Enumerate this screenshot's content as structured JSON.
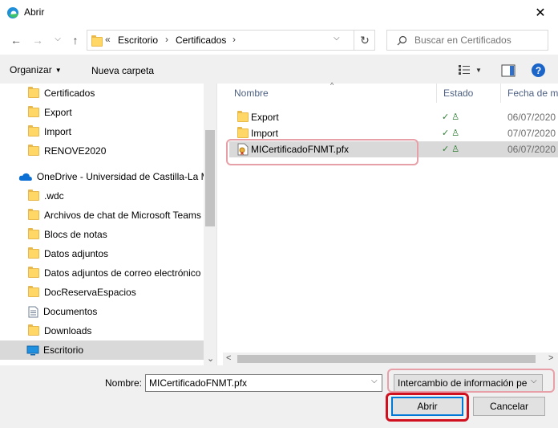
{
  "window": {
    "title": "Abrir",
    "close_glyph": "✕"
  },
  "nav": {
    "back_glyph": "←",
    "forward_glyph": "→",
    "dropdown_glyph": "⌵",
    "up_glyph": "↑",
    "address_prefix": "«",
    "path": [
      "Escritorio",
      "Certificados"
    ],
    "path_sep": "›",
    "address_dropdown_glyph": "⌵",
    "refresh_glyph": "↻",
    "search_placeholder": "Buscar en Certificados"
  },
  "toolbar": {
    "organize_label": "Organizar",
    "organize_arrow": "▼",
    "new_folder_label": "Nueva carpeta",
    "view_arrow": "▼",
    "help_glyph": "?"
  },
  "tree": [
    {
      "label": "Certificados",
      "icon": "folder-icon"
    },
    {
      "label": "Export",
      "icon": "folder-icon"
    },
    {
      "label": "Import",
      "icon": "folder-icon"
    },
    {
      "label": "RENOVE2020",
      "icon": "folder-icon"
    },
    {
      "label": "OneDrive - Universidad de Castilla-La Mancha",
      "icon": "onedrive-icon"
    },
    {
      "label": ".wdc",
      "icon": "folder-icon"
    },
    {
      "label": "Archivos de chat de Microsoft Teams",
      "icon": "folder-icon"
    },
    {
      "label": "Blocs de notas",
      "icon": "folder-icon"
    },
    {
      "label": "Datos adjuntos",
      "icon": "folder-icon"
    },
    {
      "label": "Datos adjuntos de correo electrónico",
      "icon": "folder-icon"
    },
    {
      "label": "DocReservaEspacios",
      "icon": "folder-icon"
    },
    {
      "label": "Documentos",
      "icon": "document-icon"
    },
    {
      "label": "Downloads",
      "icon": "folder-icon"
    },
    {
      "label": "Escritorio",
      "icon": "desktop-icon",
      "selected": true
    }
  ],
  "columns": {
    "name": "Nombre",
    "status": "Estado",
    "date": "Fecha de modificación",
    "sort_glyph": "^"
  },
  "files": [
    {
      "name": "Export",
      "type": "folder",
      "status": "✓ ♙",
      "date": "06/07/2020"
    },
    {
      "name": "Import",
      "type": "folder",
      "status": "✓ ♙",
      "date": "07/07/2020"
    },
    {
      "name": "MICertificadoFNMT.pfx",
      "type": "pfx",
      "status": "✓ ♙",
      "date": "06/07/2020",
      "selected": true
    }
  ],
  "scroll": {
    "left_glyph": "<",
    "right_glyph": ">",
    "down_glyph": "⌄"
  },
  "bottom": {
    "filename_label": "Nombre:",
    "filename_value": "MICertificadoFNMT.pfx",
    "filetype_value": "Intercambio de información personal",
    "dropdown_glyph": "⌵",
    "open_label": "Abrir",
    "cancel_label": "Cancelar"
  },
  "colors": {
    "highlight_light": "#e8a0a8",
    "highlight_strong": "#d0101e",
    "accent": "#0078d7"
  }
}
